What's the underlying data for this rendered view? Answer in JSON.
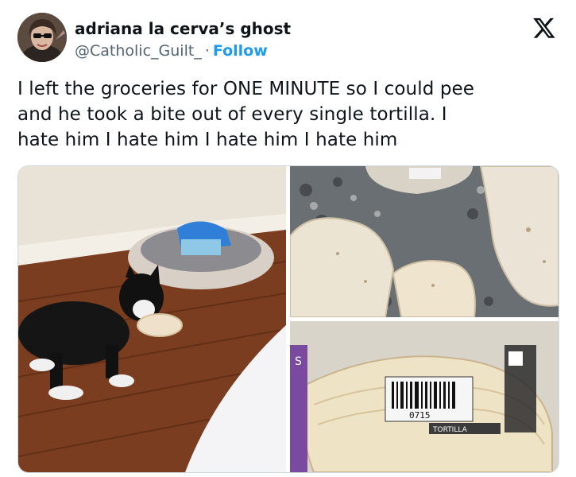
{
  "author": {
    "display_name": "adriana la cerva’s ghost",
    "handle": "@Catholic_Guilt_",
    "separator": "·",
    "follow_label": "Follow"
  },
  "tweet": {
    "lines": [
      "I left the groceries for ONE MINUTE so I could pee",
      "and he took a bite out of every single tortilla. I",
      "hate him I hate him I hate him I hate him"
    ]
  },
  "photo_text": {
    "package_number": "0715",
    "package_side": "S",
    "brand_hint": "TORTILLA"
  },
  "colors": {
    "follow": "#1d9bf0",
    "handle": "#536471",
    "text": "#0f1419"
  },
  "icons": {
    "logo": "x-logo-icon"
  }
}
